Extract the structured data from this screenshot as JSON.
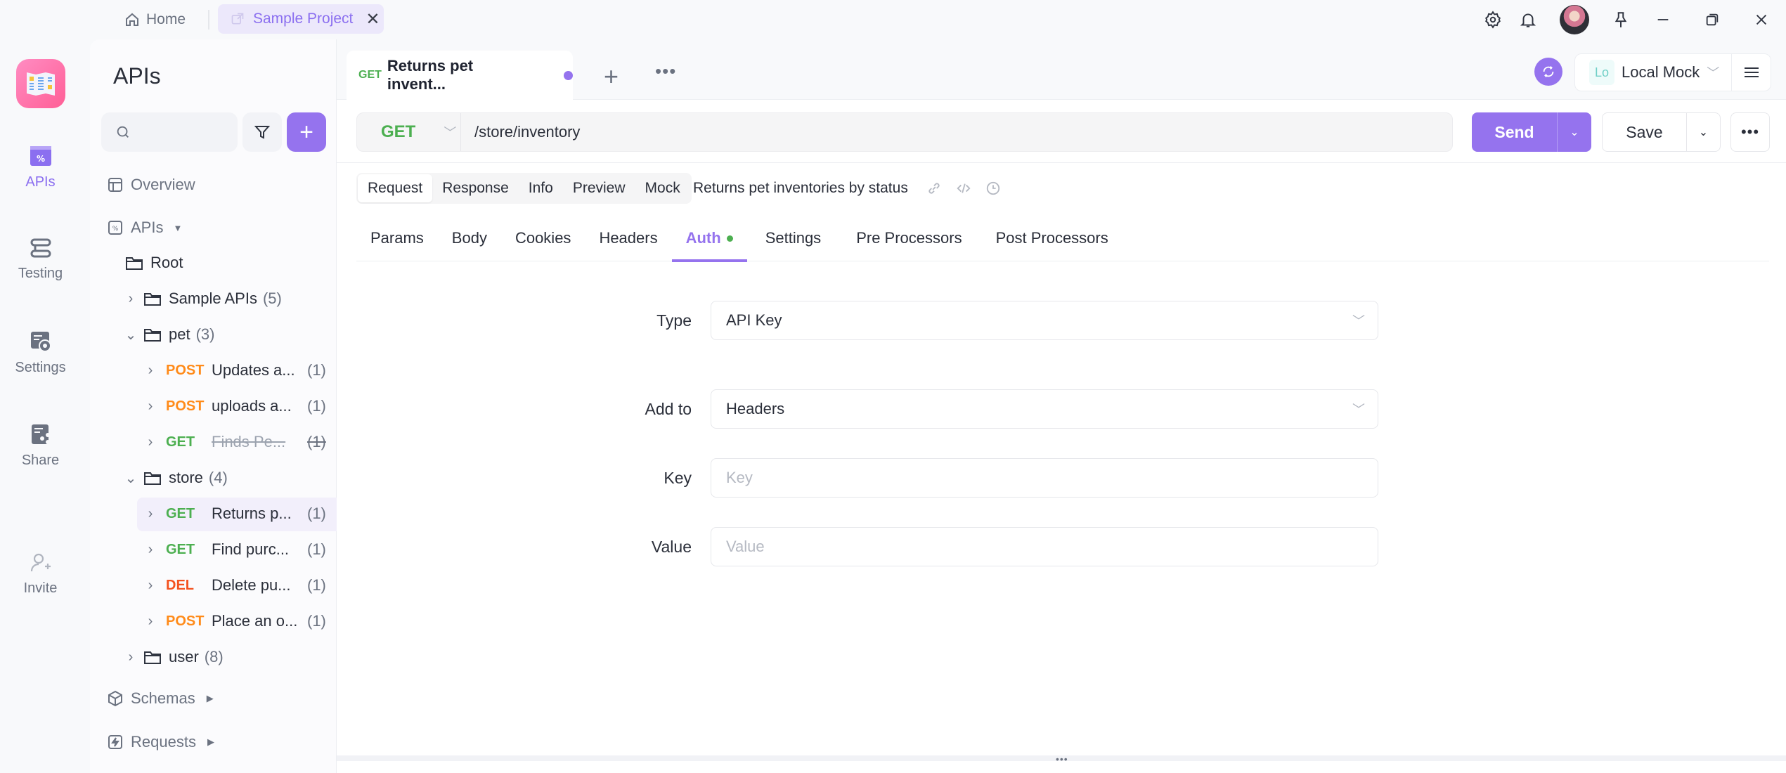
{
  "titlebar": {
    "home_label": "Home",
    "project_tab_label": "Sample Project"
  },
  "rail": {
    "items": [
      {
        "label": "APIs",
        "icon": "apis-icon",
        "active": true
      },
      {
        "label": "Testing",
        "icon": "testing-icon"
      },
      {
        "label": "Settings",
        "icon": "settings-icon"
      },
      {
        "label": "Share",
        "icon": "share-icon"
      },
      {
        "label": "Invite",
        "icon": "invite-user-icon"
      }
    ]
  },
  "tree": {
    "title": "APIs",
    "search_placeholder": "",
    "overview_label": "Overview",
    "apis_label": "APIs",
    "root_label": "Root",
    "folders": {
      "sample": {
        "name": "Sample APIs",
        "count": "(5)"
      },
      "pet": {
        "name": "pet",
        "count": "(3)"
      },
      "store": {
        "name": "store",
        "count": "(4)"
      },
      "user": {
        "name": "user",
        "count": "(8)"
      }
    },
    "pet_items": [
      {
        "method": "POST",
        "name": "Updates a...",
        "count": "(1)"
      },
      {
        "method": "POST",
        "name": "uploads a...",
        "count": "(1)"
      },
      {
        "method": "GET",
        "name": "Finds Pe...",
        "count": "(1)",
        "deprecated": true
      }
    ],
    "store_items": [
      {
        "method": "GET",
        "name": "Returns p...",
        "count": "(1)",
        "selected": true
      },
      {
        "method": "GET",
        "name": "Find purc...",
        "count": "(1)"
      },
      {
        "method": "DEL",
        "name": "Delete pu...",
        "count": "(1)"
      },
      {
        "method": "POST",
        "name": "Place an o...",
        "count": "(1)"
      }
    ],
    "schemas_label": "Schemas",
    "requests_label": "Requests"
  },
  "main": {
    "open_tab": {
      "method": "GET",
      "title": "Returns pet invent..."
    },
    "environment": {
      "badge": "Lo",
      "name": "Local Mock"
    },
    "url": {
      "method": "GET",
      "path": "/store/inventory"
    },
    "send_label": "Send",
    "save_label": "Save",
    "segments": [
      "Request",
      "Response",
      "Info",
      "Preview",
      "Mock"
    ],
    "active_segment": "Request",
    "description": "Returns pet inventories by status",
    "param_tabs": [
      "Params",
      "Body",
      "Cookies",
      "Headers",
      "Auth",
      "Settings",
      "Pre Processors",
      "Post Processors"
    ],
    "active_param_tab": "Auth",
    "auth": {
      "type_label": "Type",
      "type_value": "API Key",
      "add_to_label": "Add to",
      "add_to_value": "Headers",
      "key_label": "Key",
      "key_placeholder": "Key",
      "key_value": "",
      "value_label": "Value",
      "value_placeholder": "Value",
      "value_value": ""
    }
  },
  "colors": {
    "accent": "#9573ee",
    "get": "#4caf50",
    "post": "#ff8b1a",
    "delete": "#f4511e"
  }
}
